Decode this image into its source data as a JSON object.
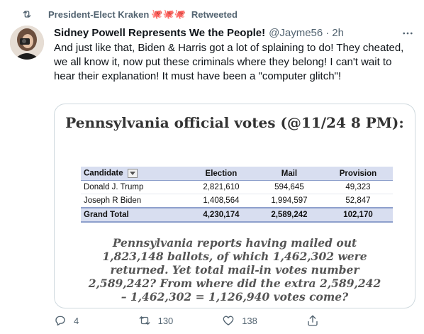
{
  "retweet": {
    "retweeter": "President-Elect Kraken",
    "emoji": "🐙🐙🐙",
    "label": "Retweeted"
  },
  "tweet": {
    "author_name": "Sidney Powell Represents We the People!",
    "handle": "@Jayme56",
    "separator": "·",
    "time": "2h",
    "text": "And just like that, Biden & Harris got a lot of splaining to do! They cheated, we all know it, now put these criminals where they belong! I can't wait to hear their explanation! It must have been a \"computer glitch\"!"
  },
  "media": {
    "title": "Pennsylvania official votes (@11/24 8 PM):",
    "table": {
      "headers": [
        "Candidate",
        "Election",
        "Mail",
        "Provision"
      ],
      "rows": [
        [
          "Donald J. Trump",
          "2,821,610",
          "594,645",
          "49,323"
        ],
        [
          "Joseph R Biden",
          "1,408,564",
          "1,994,597",
          "52,847"
        ]
      ],
      "total": [
        "Grand Total",
        "4,230,174",
        "2,589,242",
        "102,170"
      ]
    },
    "note": "Pennsylvania reports having mailed out 1,823,148 ballots, of which 1,462,302 were returned. Yet total mail-in votes number 2,589,242? From where did the extra 2,589,242 – 1,462,302 = 1,126,940 votes come?"
  },
  "actions": {
    "replies": "4",
    "retweets": "130",
    "likes": "138"
  },
  "icons": {
    "retweet": "retweet-icon",
    "more": "more-icon",
    "reply": "reply-icon",
    "like": "heart-icon",
    "share": "share-icon"
  },
  "colors": {
    "secondary_text": "#536471",
    "table_header_bg": "#d8def0"
  }
}
